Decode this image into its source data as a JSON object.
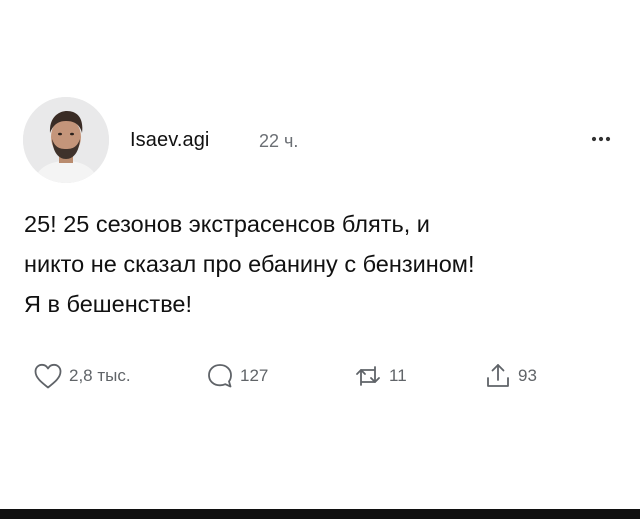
{
  "post": {
    "author": "Isaev.agi",
    "time": "22 ч.",
    "text_lines": [
      "25! 25 сезонов экстрасенсов блять, и",
      "никто не сказал про ебанину с бензином!",
      "Я в бешенстве!"
    ]
  },
  "actions": {
    "likes": "2,8 тыс.",
    "replies": "127",
    "reposts": "11",
    "shares": "93"
  },
  "icons": {
    "more": "more-horizontal-icon",
    "like": "heart-icon",
    "reply": "comment-bubble-icon",
    "repost": "repost-icon",
    "share": "share-icon"
  },
  "colors": {
    "text": "#111111",
    "muted": "#6b6f74",
    "icon": "#5f6368"
  }
}
